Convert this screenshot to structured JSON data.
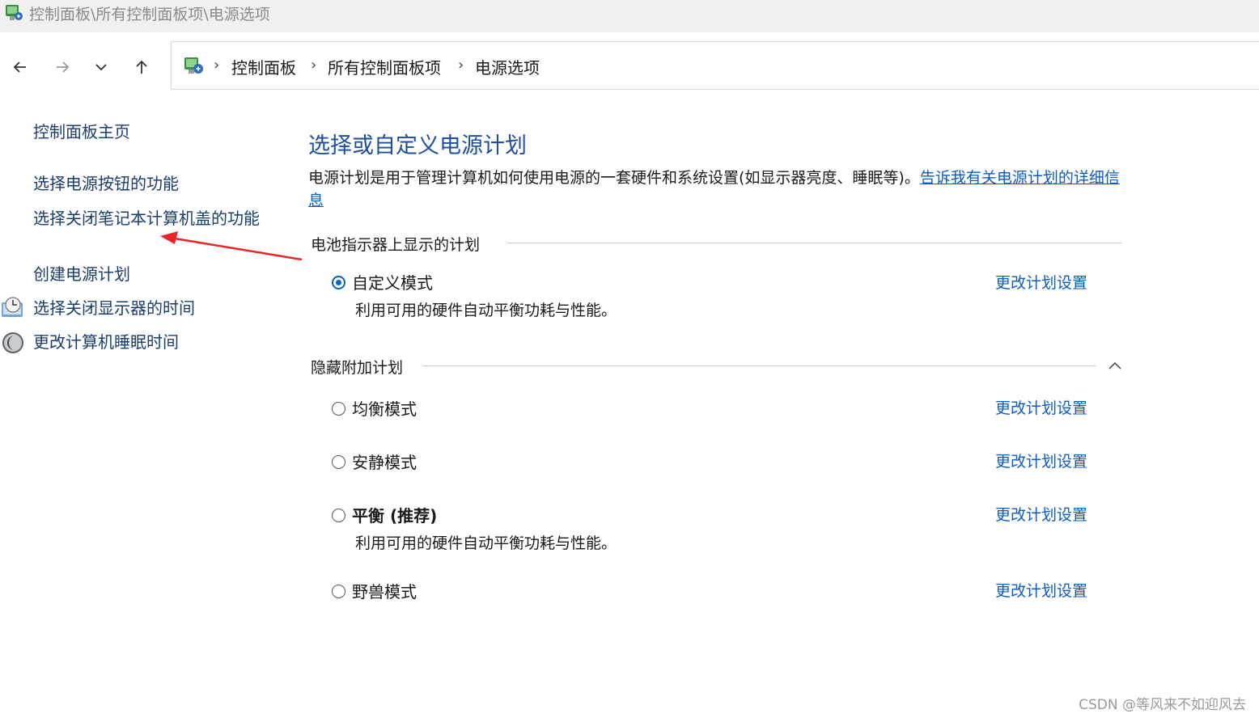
{
  "window": {
    "title": "控制面板\\所有控制面板项\\电源选项",
    "app_icon": "control-panel-icon"
  },
  "nav": {
    "back_icon": "back-arrow-icon",
    "forward_icon": "forward-arrow-icon",
    "recent_icon": "chevron-down-icon",
    "up_icon": "up-arrow-icon"
  },
  "breadcrumb": {
    "icon": "control-panel-icon",
    "items": [
      "控制面板",
      "所有控制面板项",
      "电源选项"
    ],
    "separator": "›"
  },
  "sidebar": {
    "home": "控制面板主页",
    "items": [
      {
        "label": "选择电源按钮的功能"
      },
      {
        "label": "选择关闭笔记本计算机盖的功能"
      },
      {
        "label": "创建电源计划"
      },
      {
        "label": "选择关闭显示器的时间",
        "icon": "monitor-clock-icon"
      },
      {
        "label": "更改计算机睡眠时间",
        "icon": "moon-sleep-icon"
      }
    ]
  },
  "main": {
    "title": "选择或自定义电源计划",
    "description": "电源计划是用于管理计算机如何使用电源的一套硬件和系统设置(如显示器亮度、睡眠等)。",
    "info_link": "告诉我有关电源计划的详细信息",
    "battery_section": {
      "title": "电池指示器上显示的计划",
      "plans": [
        {
          "name": "自定义模式",
          "desc": "利用可用的硬件自动平衡功耗与性能。",
          "link": "更改计划设置",
          "selected": true
        }
      ]
    },
    "hidden_section": {
      "title": "隐藏附加计划",
      "collapse_icon": "chevron-up-icon",
      "plans": [
        {
          "name": "均衡模式",
          "link": "更改计划设置",
          "selected": false
        },
        {
          "name": "安静模式",
          "link": "更改计划设置",
          "selected": false
        },
        {
          "name": "平衡 (推荐)",
          "desc": "利用可用的硬件自动平衡功耗与性能。",
          "link": "更改计划设置",
          "selected": false
        },
        {
          "name": "野兽模式",
          "link": "更改计划设置",
          "selected": false
        }
      ]
    }
  },
  "annotation": {
    "arrow_color": "#e8262a"
  },
  "watermark": "CSDN @等风来不如迎风去",
  "colors": {
    "link": "#0b5cc5",
    "title": "#1e4e9e",
    "radio_selected": "#0067c0"
  }
}
